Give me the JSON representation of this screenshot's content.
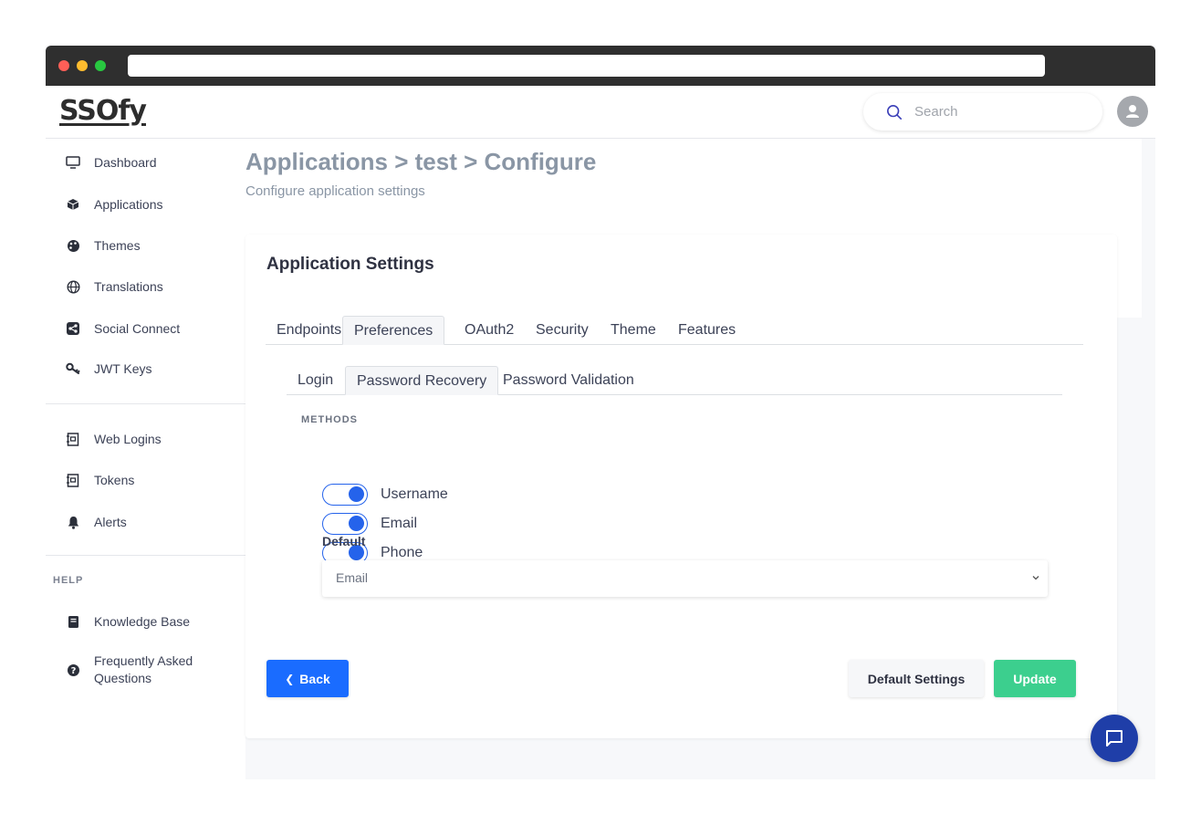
{
  "app": {
    "logo": "SSOfy"
  },
  "header": {
    "search_placeholder": "Search"
  },
  "sidebar": {
    "items": [
      {
        "label": "Dashboard",
        "icon": "monitor-icon"
      },
      {
        "label": "Applications",
        "icon": "cube-icon"
      },
      {
        "label": "Themes",
        "icon": "palette-icon"
      },
      {
        "label": "Translations",
        "icon": "globe-icon"
      },
      {
        "label": "Social Connect",
        "icon": "share-icon"
      },
      {
        "label": "JWT Keys",
        "icon": "key-icon"
      },
      {
        "label": "Web Logins",
        "icon": "web-login-icon"
      },
      {
        "label": "Tokens",
        "icon": "token-icon"
      },
      {
        "label": "Alerts",
        "icon": "bell-icon"
      }
    ],
    "help_label": "HELP",
    "help_items": [
      {
        "label": "Knowledge Base",
        "icon": "book-icon"
      },
      {
        "label": "Frequently Asked Questions",
        "icon": "question-circle-icon"
      }
    ]
  },
  "page": {
    "title": "Applications > test > Configure",
    "subtitle": "Configure application settings"
  },
  "card": {
    "title": "Application Settings",
    "tabs": [
      "Endpoints",
      "Preferences",
      "OAuth2",
      "Security",
      "Theme",
      "Features"
    ],
    "active_tab": "Preferences",
    "subtabs": [
      "Login",
      "Password Recovery",
      "Password Validation"
    ],
    "active_subtab": "Password Recovery",
    "methods_label": "METHODS",
    "methods": [
      {
        "label": "Username",
        "enabled": true
      },
      {
        "label": "Email",
        "enabled": true
      },
      {
        "label": "Phone",
        "enabled": true
      }
    ],
    "default_label": "Default",
    "default_value": "Email",
    "buttons": {
      "back": "Back",
      "default_settings": "Default Settings",
      "update": "Update"
    }
  },
  "colors": {
    "primary": "#1a6cff",
    "success": "#3ccf8e",
    "chat": "#1f3ea8",
    "toggle_on": "#2563eb"
  }
}
